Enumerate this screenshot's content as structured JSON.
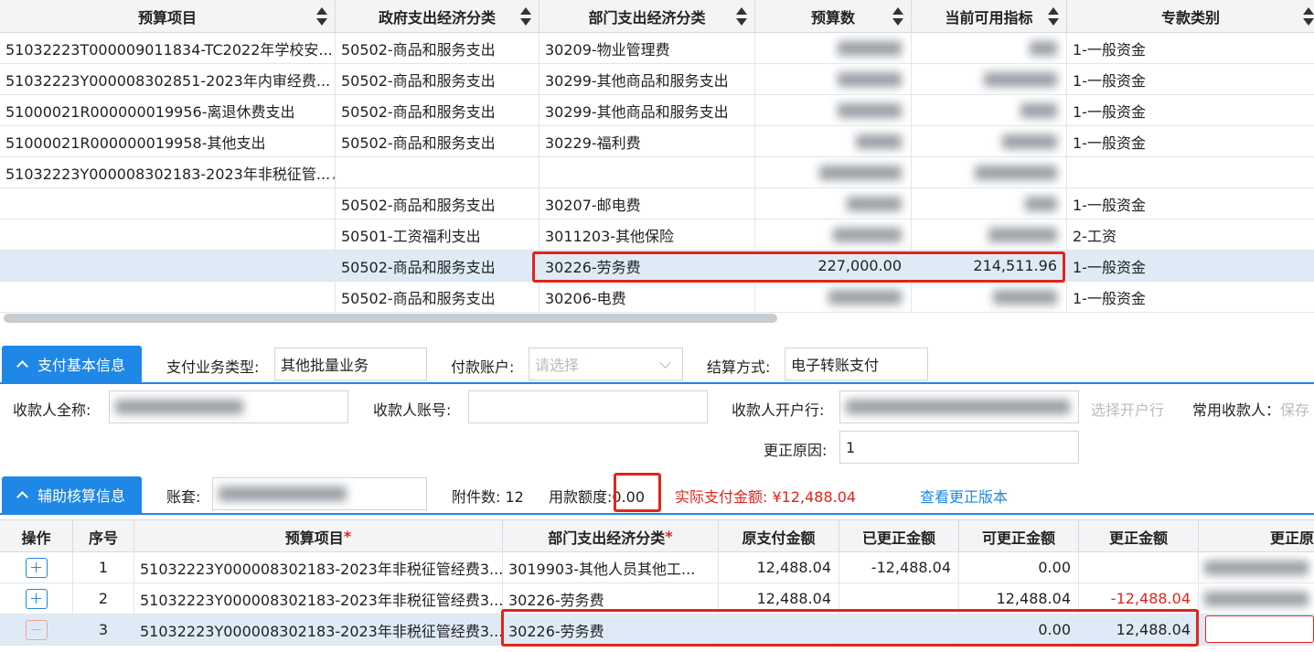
{
  "top_table": {
    "headers": [
      "预算项目",
      "政府支出经济分类",
      "部门支出经济分类",
      "预算数",
      "当前可用指标",
      "专款类别"
    ],
    "rows": [
      {
        "project": "51032223T000009011834-TC2022年学校安...",
        "gov": "50502-商品和服务支出",
        "dept": "30209-物业管理费",
        "budget": "",
        "avail": "",
        "fund": "1-一般资金"
      },
      {
        "project": "51032223Y000008302851-2023年内审经费...",
        "gov": "50502-商品和服务支出",
        "dept": "30299-其他商品和服务支出",
        "budget": "",
        "avail": "",
        "fund": "1-一般资金"
      },
      {
        "project": "51000021R000000019956-离退休费支出",
        "gov": "50502-商品和服务支出",
        "dept": "30299-其他商品和服务支出",
        "budget": "",
        "avail": "",
        "fund": "1-一般资金"
      },
      {
        "project": "51000021R000000019958-其他支出",
        "gov": "50502-商品和服务支出",
        "dept": "30229-福利费",
        "budget": "",
        "avail": "",
        "fund": "1-一般资金"
      },
      {
        "project": "51032223Y000008302183-2023年非税征管...",
        "gov": "",
        "dept": "",
        "budget": "",
        "avail": "",
        "fund": ""
      },
      {
        "project": "",
        "gov": "50502-商品和服务支出",
        "dept": "30207-邮电费",
        "budget": "",
        "avail": "",
        "fund": "1-一般资金"
      },
      {
        "project": "",
        "gov": "50501-工资福利支出",
        "dept": "3011203-其他保险",
        "budget": "",
        "avail": "",
        "fund": "2-工资"
      },
      {
        "project": "",
        "gov": "50502-商品和服务支出",
        "dept": "30226-劳务费",
        "budget": "227,000.00",
        "avail": "214,511.96",
        "fund": "1-一般资金"
      },
      {
        "project": "",
        "gov": "50502-商品和服务支出",
        "dept": "30206-电费",
        "budget": "",
        "avail": "",
        "fund": "1-一般资金"
      }
    ]
  },
  "pay_info": {
    "tab_label": "支付基本信息",
    "biz_type_label": "支付业务类型:",
    "biz_type_value": "其他批量业务",
    "account_label": "付款账户:",
    "account_placeholder": "请选择",
    "settle_label": "结算方式:",
    "settle_value": "电子转账支付",
    "payee_name_label": "收款人全称:",
    "payee_acct_label": "收款人账号:",
    "payee_bank_label": "收款人开户行:",
    "select_bank_label": "选择开户行",
    "common_payee_label": "常用收款人：",
    "common_payee_save": "保存",
    "reason_label": "更正原因:",
    "reason_value": "1"
  },
  "aux_info": {
    "tab_label": "辅助核算信息",
    "ledger_label": "账套:",
    "attach_label": "附件数:",
    "attach_value": "12",
    "quota_label": "用款额度:",
    "quota_value": "0.00",
    "actual_label": "实际支付金额:",
    "actual_value": "¥12,488.04",
    "view_versions": "查看更正版本"
  },
  "bottom_table": {
    "headers": [
      "操作",
      "序号",
      "预算项目",
      "部门支出经济分类",
      "原支付金额",
      "已更正金额",
      "可更正金额",
      "更正金额",
      "更正原"
    ],
    "rows": [
      {
        "idx": "1",
        "project": "51032223Y000008302183-2023年非税征管经费3...",
        "dept": "3019903-其他人员其他工...",
        "orig": "12,488.04",
        "corrected": "-12,488.04",
        "correctable": "0.00",
        "amount": ""
      },
      {
        "idx": "2",
        "project": "51032223Y000008302183-2023年非税征管经费3...",
        "dept": "30226-劳务费",
        "orig": "12,488.04",
        "corrected": "",
        "correctable": "12,488.04",
        "amount": "-12,488.04"
      },
      {
        "idx": "3",
        "project": "51032223Y000008302183-2023年非税征管经费3...",
        "dept": "30226-劳务费",
        "orig": "",
        "corrected": "",
        "correctable": "0.00",
        "amount": "12,488.04"
      }
    ]
  },
  "colors": {
    "accent": "#1f87e5",
    "highlight": "#e3241b",
    "selected_row": "#deebf7"
  }
}
